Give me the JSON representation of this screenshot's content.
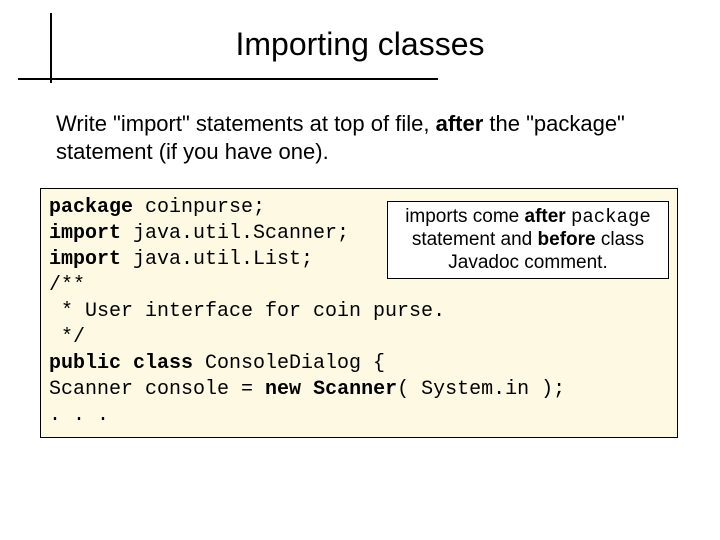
{
  "title": "Importing classes",
  "desc_pre": "Write \"import\" statements at top of file, ",
  "desc_bold": "after",
  "desc_post": " the \"package\" statement (if you have one).",
  "code": {
    "l1a": "package",
    "l1b": " coinpurse;",
    "l2a": "import",
    "l2b": " java.util.Scanner;",
    "l3a": "import",
    "l3b": " java.util.List;",
    "l4": "/**",
    "l5": " * User interface for coin purse.",
    "l6": " */",
    "l7a": "public class",
    "l7b": " ConsoleDialog {",
    "l8a": "Scanner console = ",
    "l8b": "new",
    "l8c": " ",
    "l8d": "Scanner",
    "l8e": "( System.in );",
    "l9": ". . ."
  },
  "callout": {
    "p1a": "imports come ",
    "p1b": "after",
    "p1c": " ",
    "p1mono": "package",
    "p2a": "statement and ",
    "p2b": "before",
    "p2c": " class",
    "p3": "Javadoc comment."
  }
}
